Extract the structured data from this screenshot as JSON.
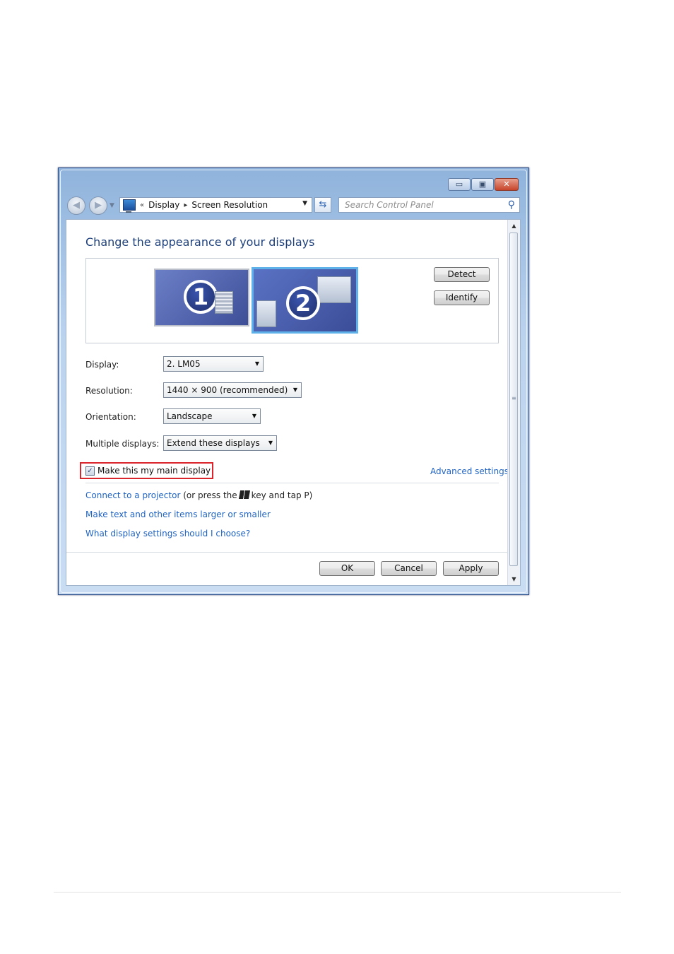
{
  "window": {
    "caption_buttons": {
      "minimize_icon": "minimize-icon",
      "maximize_icon": "maximize-icon",
      "close_icon": "close-icon"
    }
  },
  "navbar": {
    "back_icon": "back-arrow-icon",
    "forward_icon": "forward-arrow-icon",
    "address": {
      "prefix": "«",
      "crumbs": [
        "Display",
        "Screen Resolution"
      ],
      "separator": "▸"
    },
    "refresh_icon": "refresh-icon",
    "search": {
      "placeholder": "Search Control Panel",
      "icon": "search-icon"
    }
  },
  "main": {
    "title": "Change the appearance of your displays",
    "monitors": [
      {
        "number": "1",
        "selected": false
      },
      {
        "number": "2",
        "selected": true
      }
    ],
    "detect_label": "Detect",
    "identify_label": "Identify",
    "fields": {
      "display": {
        "label": "Display:",
        "value": "2. LM05"
      },
      "resolution": {
        "label": "Resolution:",
        "value": "1440 × 900 (recommended)"
      },
      "orientation": {
        "label": "Orientation:",
        "value": "Landscape"
      },
      "multiple": {
        "label": "Multiple displays:",
        "value": "Extend these displays"
      }
    },
    "main_display_checkbox": {
      "label": "Make this my main display",
      "checked": true,
      "highlight_color": "#d9252b"
    },
    "advanced_settings": "Advanced settings",
    "links": {
      "projector_link": "Connect to a projector",
      "projector_text_before": "(or press the",
      "projector_text_after": "key and tap P)",
      "text_size": "Make text and other items larger or smaller",
      "help": "What display settings should I choose?"
    },
    "buttons": {
      "ok": "OK",
      "cancel": "Cancel",
      "apply": "Apply"
    }
  },
  "colors": {
    "link": "#1f63c2",
    "title": "#1d3f7a",
    "selection_border": "#5fb1ea"
  }
}
